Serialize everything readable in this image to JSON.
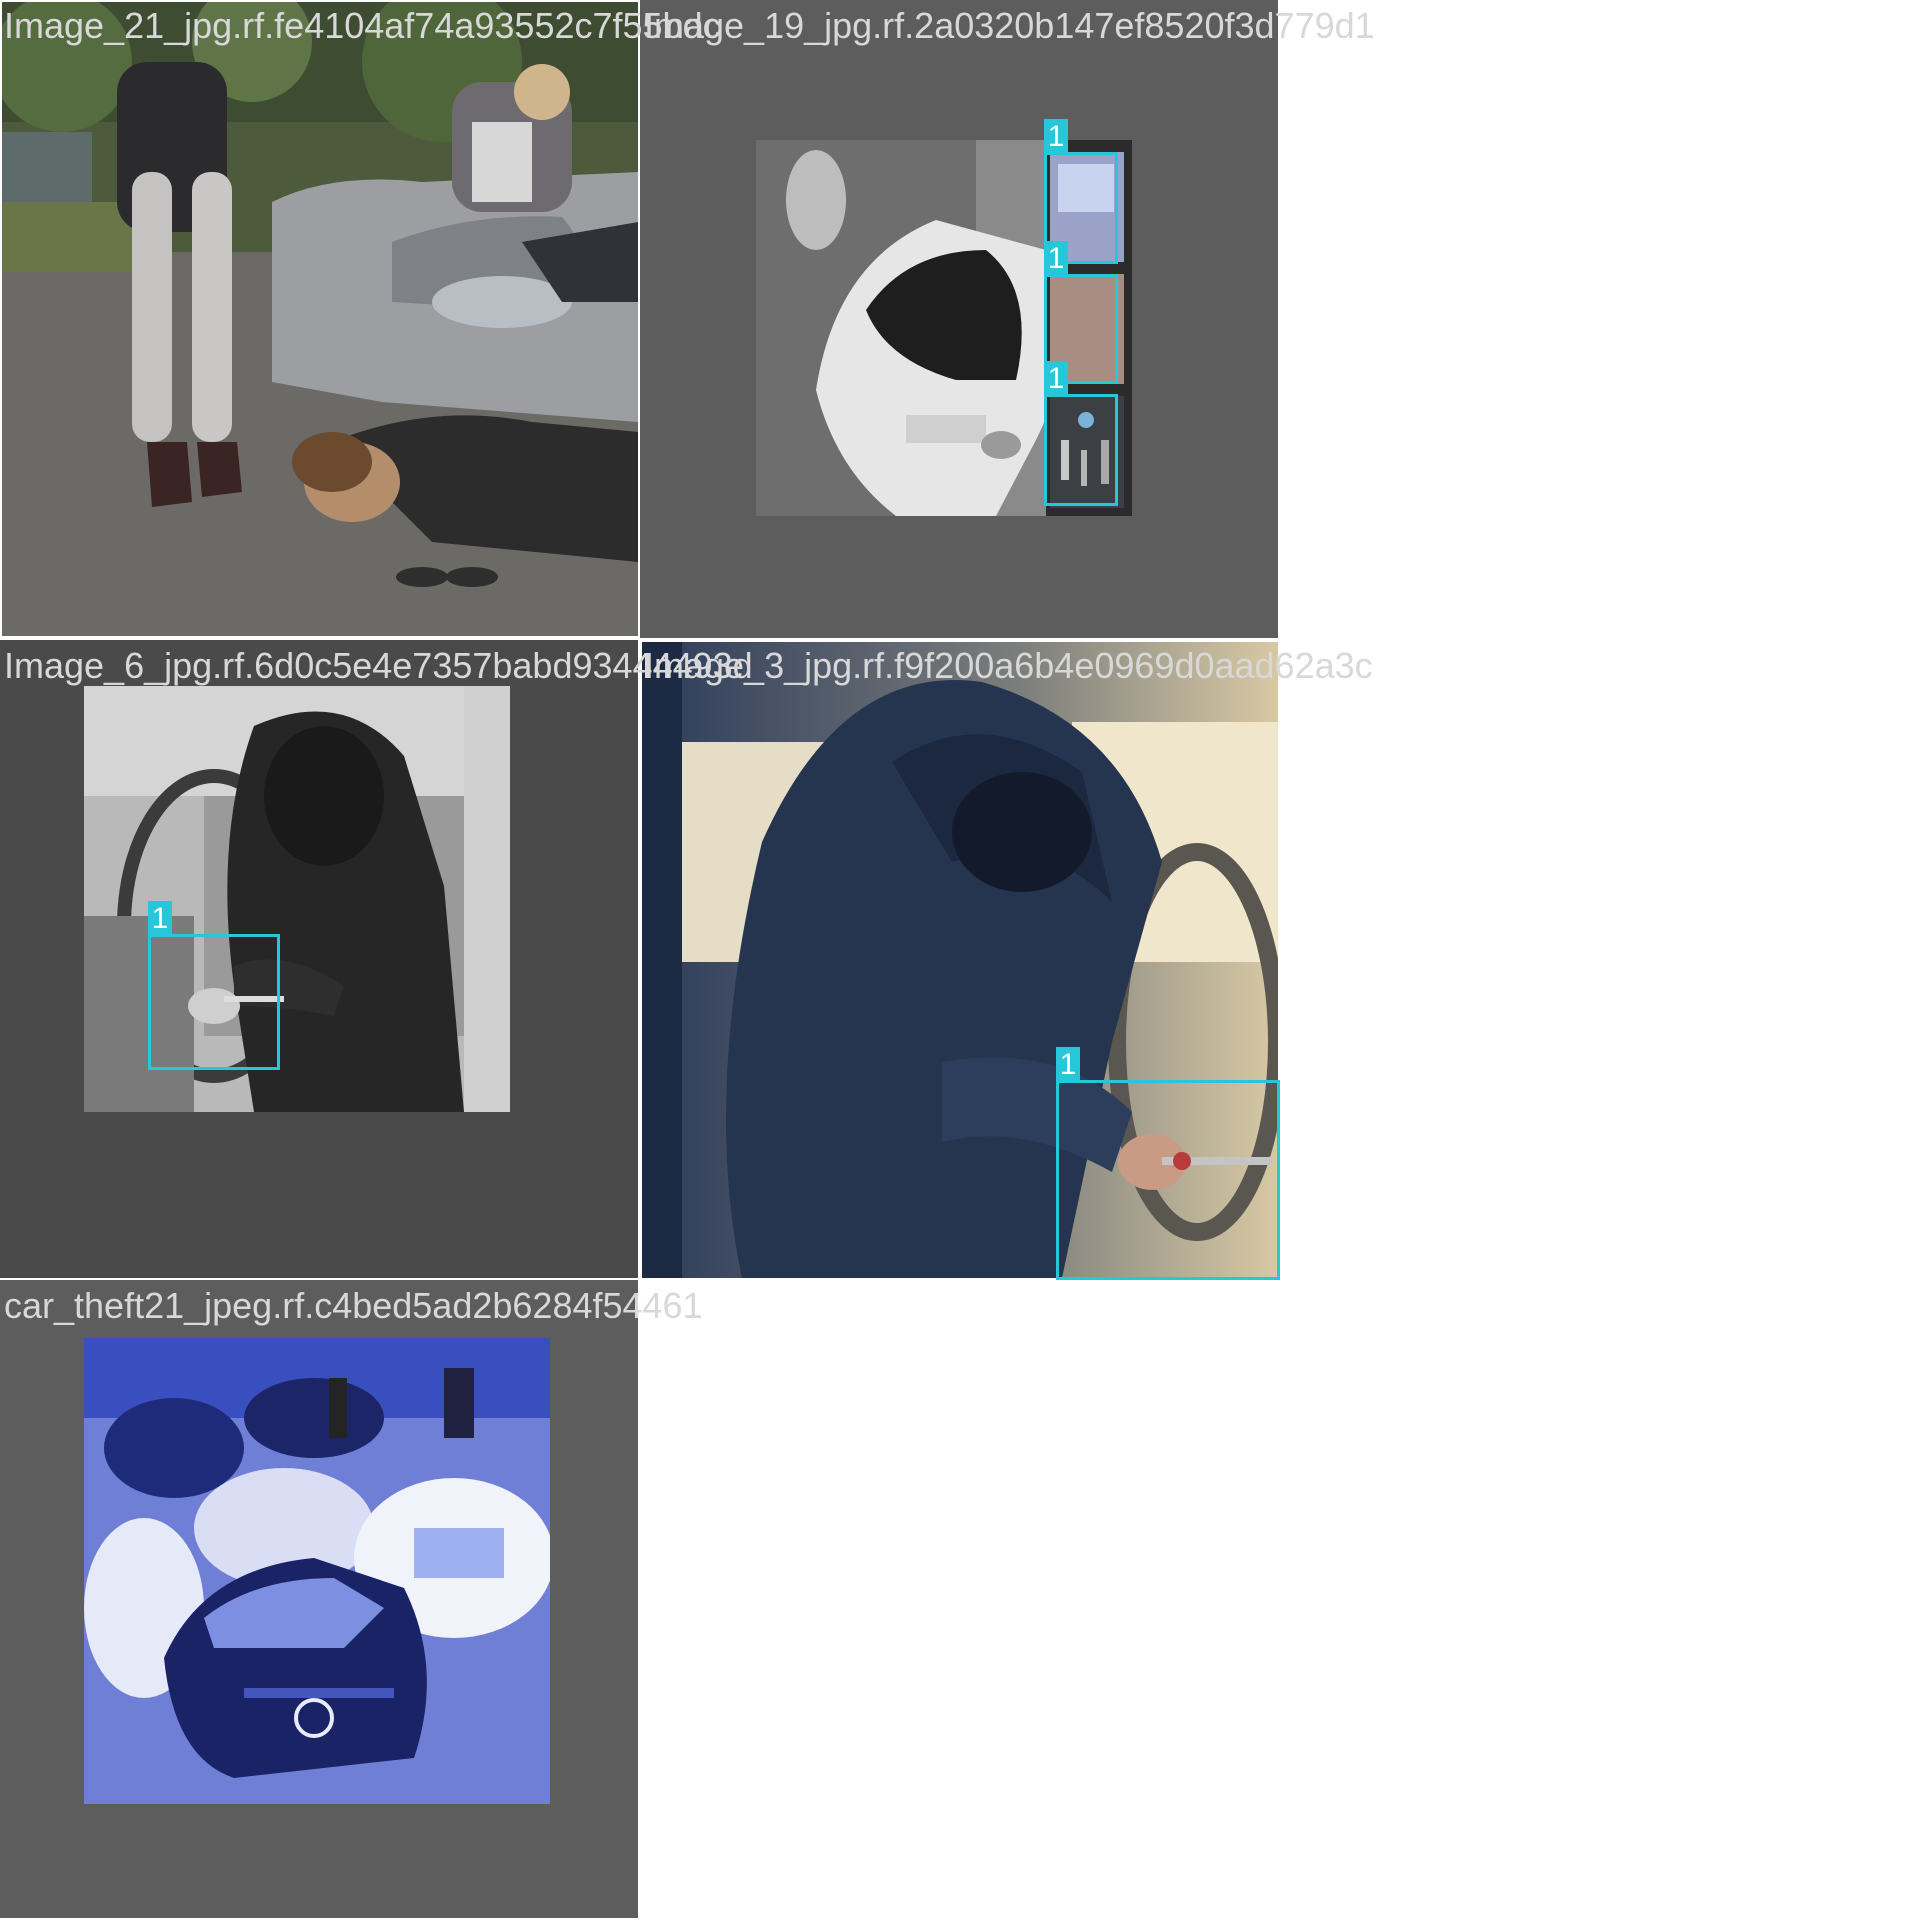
{
  "mosaic": {
    "tiles": [
      {
        "caption": "Image_21_jpg.rf.fe4104af74a93552c7f55bdc",
        "boxes": []
      },
      {
        "caption": "Image_19_jpg.rf.2a0320b147ef8520f3d779d1",
        "boxes": [
          {
            "label": "1"
          },
          {
            "label": "1"
          },
          {
            "label": "1"
          }
        ]
      },
      {
        "caption": "Image_6_jpg.rf.6d0c5e4e7357babd93444493d",
        "boxes": [
          {
            "label": "1"
          }
        ]
      },
      {
        "caption": "Image_3_jpg.rf.f9f200a6b4e0969d0aad62a3c",
        "boxes": [
          {
            "label": "1"
          }
        ]
      },
      {
        "caption": "car_theft21_jpeg.rf.c4bed5ad2b6284f54461",
        "boxes": []
      }
    ]
  },
  "colors": {
    "box": "#26c7d9",
    "padding": "#5d5d5d",
    "caption": "#d8d8d8"
  },
  "scenes": [
    "woman in heels standing by car, man lying on road, man leaning on car door",
    "grayscale white car with strip of three thief-tool photos",
    "hooded person in car with screwdriver at ignition (grayscale)",
    "hooded person in car forcing ignition with screwdriver",
    "surveillance view of parked cars at night (blue tint)"
  ]
}
